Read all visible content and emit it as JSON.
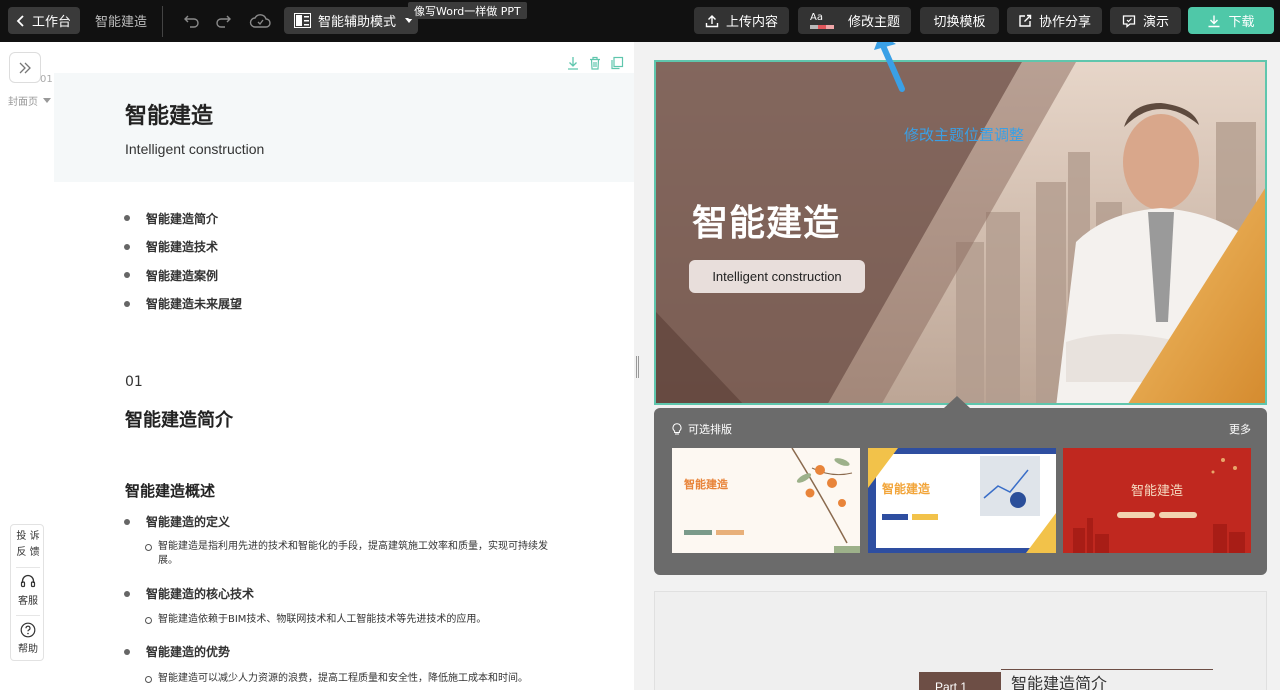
{
  "topbar": {
    "back_label": "工作台",
    "doc_name": "智能建造",
    "mode_label": "智能辅助模式",
    "tooltip": "像写Word一样做 PPT",
    "upload_label": "上传内容",
    "theme_aa": "Aa",
    "theme_label": "修改主题",
    "switch_label": "切换模板",
    "share_label": "协作分享",
    "present_label": "演示",
    "download_label": "下载"
  },
  "editor": {
    "page_number": "01",
    "page_label": "封面页",
    "cover_title": "智能建造",
    "cover_subtitle": "Intelligent construction",
    "toc": [
      "智能建造简介",
      "智能建造技术",
      "智能建造案例",
      "智能建造未来展望"
    ],
    "section_number": "01",
    "section_title": "智能建造简介",
    "subsection_title": "智能建造概述",
    "items": [
      {
        "label": "智能建造的定义",
        "detail": "智能建造是指利用先进的技术和智能化的手段，提高建筑施工效率和质量，实现可持续发展。"
      },
      {
        "label": "智能建造的核心技术",
        "detail": "智能建造依赖于BIM技术、物联网技术和人工智能技术等先进技术的应用。"
      },
      {
        "label": "智能建造的优势",
        "detail": "智能建造可以减少人力资源的浪费，提高工程质量和安全性，降低施工成本和时间。"
      }
    ]
  },
  "feedback": {
    "report_line1": "投 诉",
    "report_line2": "反 馈",
    "service_label": "客服",
    "help_label": "帮助"
  },
  "preview": {
    "slide_title": "智能建造",
    "slide_subtitle": "Intelligent construction",
    "annotation": "修改主题位置调整",
    "layout_popup_title": "可选排版",
    "layout_more": "更多",
    "thumbs": [
      {
        "title": "智能建造"
      },
      {
        "title": "智能建造"
      },
      {
        "title": "智能建造"
      }
    ],
    "next_part": "Part 1",
    "next_title": "智能建造简介"
  },
  "colors": {
    "accent": "#4fc8a8",
    "annotation": "#3aa0e6",
    "slide_brown": "#6d4e45",
    "slide_gold": "#e6a53a"
  }
}
